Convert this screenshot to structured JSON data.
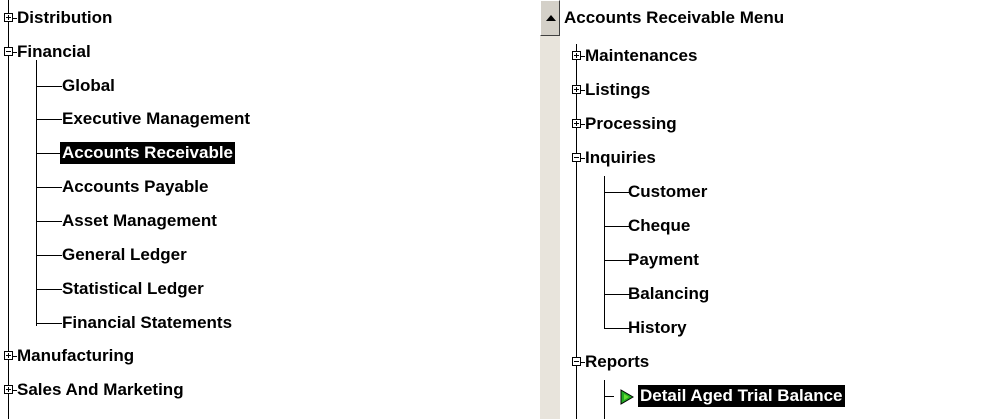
{
  "left_tree": {
    "items": {
      "distribution": "Distribution",
      "financial": "Financial",
      "global": "Global",
      "executive_management": "Executive Management",
      "accounts_receivable": "Accounts Receivable",
      "accounts_payable": "Accounts Payable",
      "asset_management": "Asset Management",
      "general_ledger": "General Ledger",
      "statistical_ledger": "Statistical Ledger",
      "financial_statements": "Financial Statements",
      "manufacturing": "Manufacturing",
      "sales_and_marketing": "Sales And Marketing"
    },
    "selected": "Accounts Receivable"
  },
  "right_tree": {
    "title": "Accounts Receivable Menu",
    "items": {
      "maintenances": "Maintenances",
      "listings": "Listings",
      "processing": "Processing",
      "inquiries": "Inquiries",
      "customer": "Customer",
      "cheque": "Cheque",
      "payment": "Payment",
      "balancing": "Balancing",
      "history": "History",
      "reports": "Reports",
      "detail_aged_trial_balance": "Detail Aged Trial Balance"
    },
    "selected": "Detail Aged Trial Balance"
  },
  "icons": {
    "expand": "plus-box-icon",
    "collapse": "minus-box-icon",
    "run_report": "green-arrow-icon",
    "scroll_up": "scroll-up-arrow-icon"
  },
  "colors": {
    "selection_bg": "#000000",
    "selection_fg": "#ffffff",
    "arrow_green": "#22aa22",
    "scrollbar": "#d4d0c8"
  }
}
